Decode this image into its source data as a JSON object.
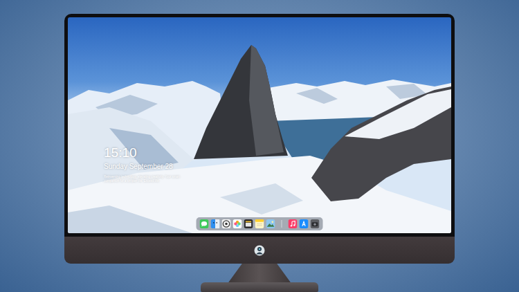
{
  "lock_screen": {
    "time": "15:10",
    "date": "Sunday September 28",
    "tagline": "Reinventing technology, elevating creativity. Your smart companion for a simpler life. Exceed life."
  },
  "dock": {
    "apps": [
      {
        "kind": "messages"
      },
      {
        "kind": "files"
      },
      {
        "kind": "browser"
      },
      {
        "kind": "photos"
      },
      {
        "kind": "video"
      },
      {
        "kind": "notes"
      },
      {
        "kind": "gallery"
      }
    ],
    "pinned": [
      {
        "kind": "music"
      },
      {
        "kind": "store"
      },
      {
        "kind": "camera"
      }
    ]
  }
}
